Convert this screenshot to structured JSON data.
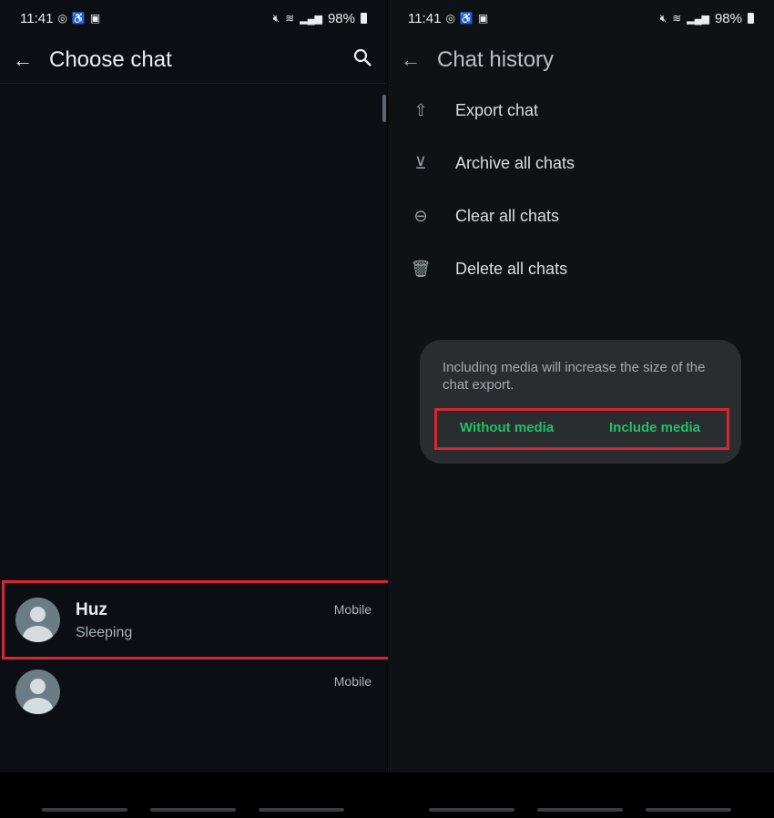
{
  "status": {
    "time": "11:41",
    "battery": "98%",
    "icons": [
      "whatsapp-icon",
      "accessibility-icon",
      "image-icon",
      "mute-icon",
      "wifi-icon",
      "signal-icon",
      "battery-icon"
    ]
  },
  "left": {
    "title": "Choose chat",
    "chats": [
      {
        "name": "Huz",
        "status": "Sleeping",
        "tag": "Mobile"
      },
      {
        "name": "",
        "status": "",
        "tag": "Mobile"
      }
    ]
  },
  "right": {
    "title": "Chat history",
    "menu": [
      {
        "icon": "upload-icon",
        "label": "Export chat"
      },
      {
        "icon": "archive-icon",
        "label": "Archive all chats"
      },
      {
        "icon": "minus-circle-icon",
        "label": "Clear all chats"
      },
      {
        "icon": "trash-icon",
        "label": "Delete all chats"
      }
    ],
    "dialog": {
      "message": "Including media will increase the size of the chat export.",
      "without": "Without media",
      "include": "Include media"
    }
  },
  "colors": {
    "accent": "#21c063",
    "highlight": "#d8262e",
    "background": "#0b0f13"
  }
}
